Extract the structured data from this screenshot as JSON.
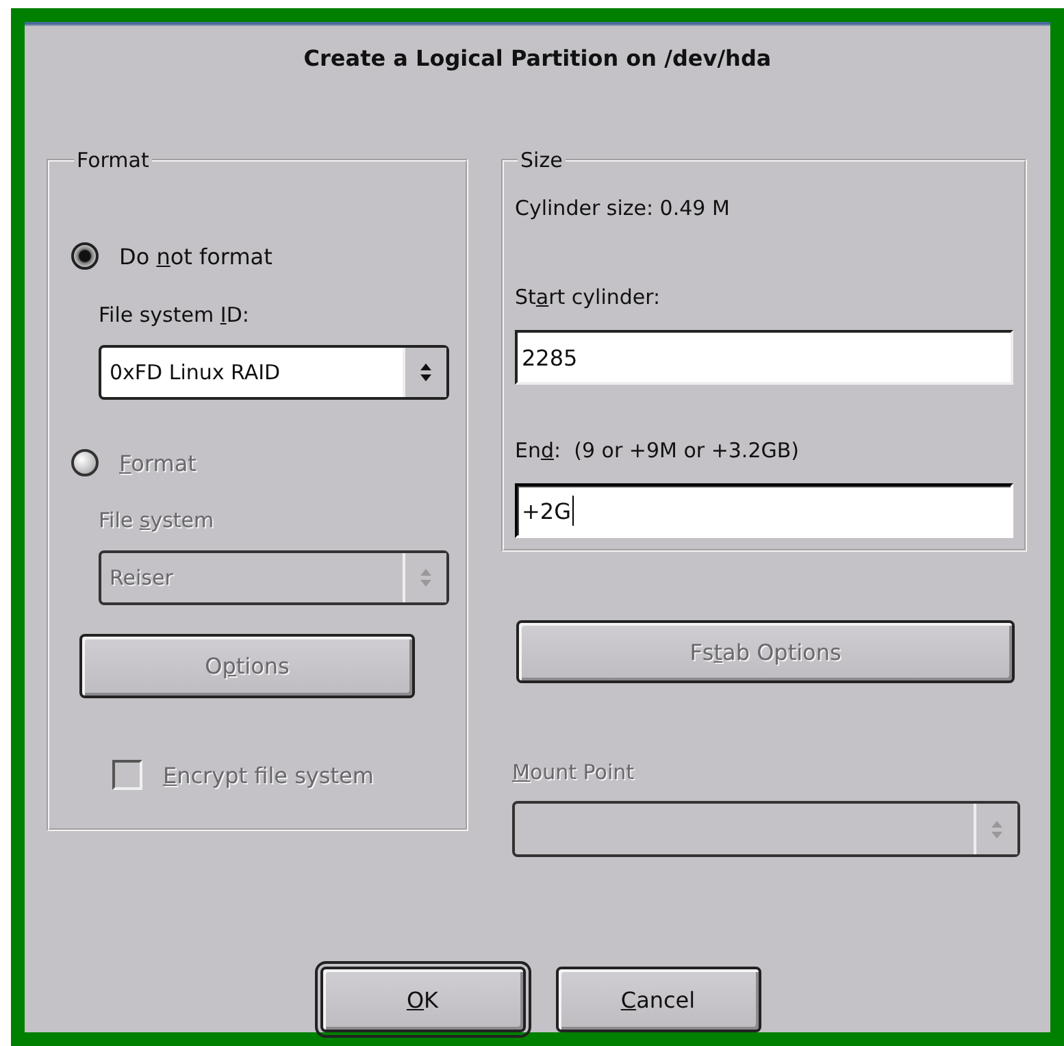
{
  "window": {
    "title": "Create a Logical Partition on /dev/hda"
  },
  "format_group": {
    "legend": "Format",
    "items": [
      {
        "kind": "radio",
        "label": {
          "before": "Do ",
          "mnemonic": "n",
          "after": "ot format"
        },
        "selected": true,
        "disabled": false
      },
      {
        "kind": "select",
        "label": {
          "before": "File system ",
          "mnemonic": "I",
          "after": "D:"
        },
        "value": "0xFD Linux RAID",
        "disabled": false
      },
      {
        "kind": "radio",
        "label": {
          "mnemonic": "F",
          "after": "ormat"
        },
        "selected": false,
        "disabled": true
      },
      {
        "kind": "select",
        "label": {
          "before": "File ",
          "mnemonic": "s",
          "after": "ystem"
        },
        "value": "Reiser",
        "disabled": true
      },
      {
        "kind": "button",
        "label": {
          "before": "O",
          "mnemonic": "p",
          "after": "tions"
        },
        "disabled": true
      },
      {
        "kind": "checkbox",
        "label": {
          "mnemonic": "E",
          "after": "ncrypt file system"
        },
        "checked": false,
        "disabled": true
      }
    ]
  },
  "size_group": {
    "legend": "Size",
    "items": [
      {
        "kind": "text",
        "label": "Cylinder size: 0.49 M"
      },
      {
        "kind": "field",
        "label": {
          "before": "St",
          "mnemonic": "a",
          "after": "rt cylinder:"
        },
        "value": "2285",
        "focused": false
      },
      {
        "kind": "field",
        "label": {
          "before": "En",
          "mnemonic": "d",
          "after": ":  (9 or +9M or +3.2GB)"
        },
        "value": "+2G",
        "focused": true
      }
    ]
  },
  "right_items": [
    {
      "kind": "button",
      "label": {
        "before": "Fs",
        "mnemonic": "t",
        "after": "ab Options"
      },
      "disabled": true
    },
    {
      "kind": "select",
      "label": {
        "mnemonic": "M",
        "after": "ount Point"
      },
      "disabled": true
    }
  ],
  "buttons": [
    {
      "label": {
        "mnemonic": "O",
        "after": "K"
      },
      "default": true
    },
    {
      "label": {
        "mnemonic": "C",
        "after": "ancel"
      },
      "default": false
    }
  ]
}
